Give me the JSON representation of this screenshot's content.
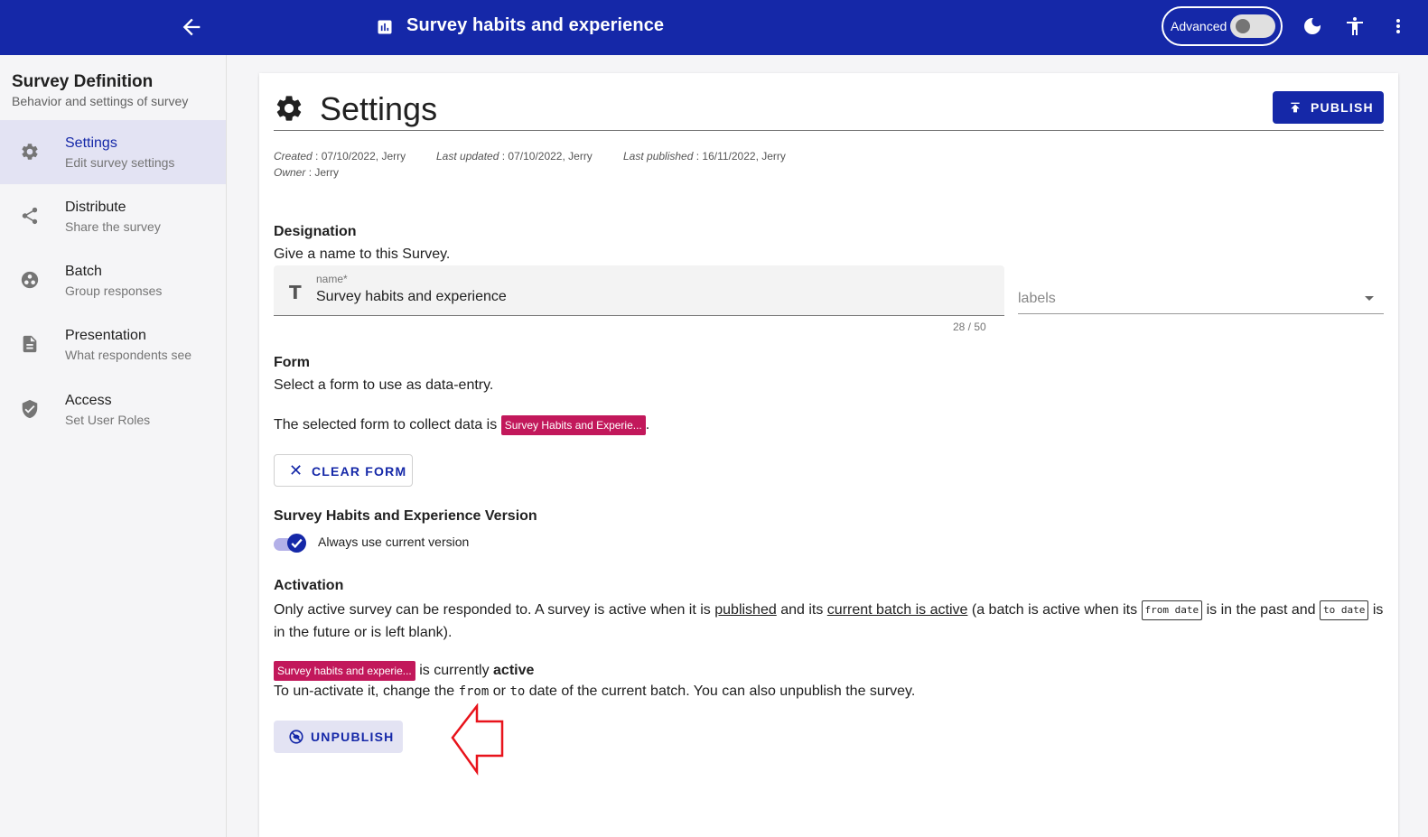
{
  "topbar": {
    "title": "Survey habits and experience",
    "advanced_label": "Advanced",
    "advanced_on": false,
    "bg_color": "#1528a8"
  },
  "sidebar": {
    "title": "Survey Definition",
    "subtitle": "Behavior and settings of survey",
    "items": [
      {
        "label": "Settings",
        "sublabel": "Edit survey settings",
        "icon": "gear-icon",
        "active": true
      },
      {
        "label": "Distribute",
        "sublabel": "Share the survey",
        "icon": "share-icon",
        "active": false
      },
      {
        "label": "Batch",
        "sublabel": "Group responses",
        "icon": "batch-icon",
        "active": false
      },
      {
        "label": "Presentation",
        "sublabel": "What respondents see",
        "icon": "document-icon",
        "active": false
      },
      {
        "label": "Access",
        "sublabel": "Set User Roles",
        "icon": "shield-icon",
        "active": false
      }
    ]
  },
  "main": {
    "heading": "Settings",
    "publish_label": "PUBLISH",
    "meta": {
      "created_label": "Created",
      "created_value": ": 07/10/2022, Jerry",
      "owner_label": "Owner",
      "owner_value": ": Jerry",
      "updated_label": "Last updated",
      "updated_value": ": 07/10/2022, Jerry",
      "published_label": "Last published",
      "published_value": ": 16/11/2022, Jerry"
    },
    "designation": {
      "heading": "Designation",
      "text": "Give a name to this Survey.",
      "name_label": "name*",
      "name_value": "Survey habits and experience",
      "counter": "28 / 50",
      "labels_placeholder": "labels"
    },
    "form": {
      "heading": "Form",
      "text": "Select a form to use as data-entry.",
      "selected_prefix": "The selected form to collect data is",
      "selected_chip": "Survey Habits and Experie...",
      "selected_suffix": ".",
      "clear_label": "CLEAR FORM"
    },
    "version": {
      "heading": "Survey Habits and Experience Version",
      "toggle_label": "Always use current version",
      "toggle_on": true
    },
    "activation": {
      "heading": "Activation",
      "p1": "Only active survey can be responded to. A survey is active when it is",
      "published_link": "published",
      "p2": "and its",
      "batch_link": "current batch is active",
      "p3": "(a batch is active when its",
      "from_code": "from date",
      "p4": "is in the past and",
      "to_code": "to date",
      "p5": "is",
      "p6": "in the future or is left blank).",
      "status_chip": "Survey habits and experie...",
      "status_prefix": "is currently",
      "status_value": "active",
      "hint1": "To un-activate it, change the",
      "hint_from": "from",
      "hint_or": "or",
      "hint_to": "to",
      "hint2": "date of the current batch. You can also unpublish the survey.",
      "unpublish_label": "UNPUBLISH"
    }
  }
}
